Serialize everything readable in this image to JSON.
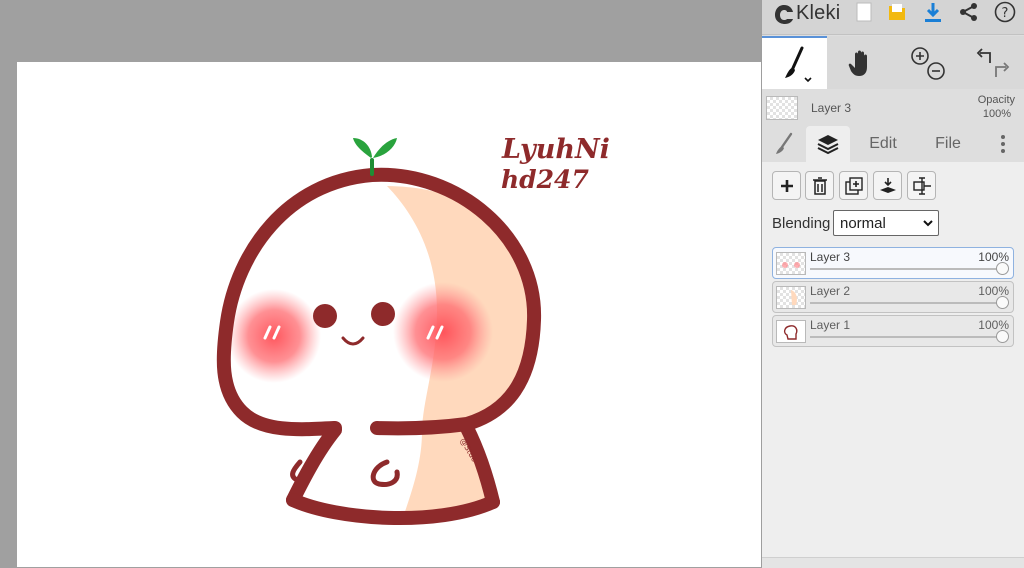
{
  "app": {
    "name": "Kleki"
  },
  "toolbar": {
    "icons": [
      "new-page-icon",
      "save-icon",
      "download-icon",
      "share-icon",
      "help-icon"
    ],
    "tools": [
      "brush-tool-icon",
      "hand-tool-icon",
      "zoom-in-icon",
      "zoom-out-icon",
      "undo-icon",
      "redo-icon"
    ]
  },
  "current_layer": {
    "name": "Layer 3",
    "opacity_label": "Opacity",
    "opacity_value": "100%"
  },
  "tabs": {
    "edit": "Edit",
    "file": "File"
  },
  "layers_panel": {
    "blending_label": "Blending",
    "blending_value": "normal",
    "layers": [
      {
        "name": "Layer 3",
        "opacity": "100%",
        "selected": true
      },
      {
        "name": "Layer 2",
        "opacity": "100%",
        "selected": false
      },
      {
        "name": "Layer 1",
        "opacity": "100%",
        "selected": false
      }
    ]
  },
  "canvas": {
    "signature": [
      "LyuhNi",
      "hd247"
    ],
    "watermark": "@Stuo"
  },
  "colors": {
    "outline": "#8e2a2b",
    "skin": "#ffd9bd",
    "blush": "#ff5a61",
    "sprout": "#29a33d",
    "accent": "#1a7fd6",
    "save_yellow": "#f2b90f"
  }
}
